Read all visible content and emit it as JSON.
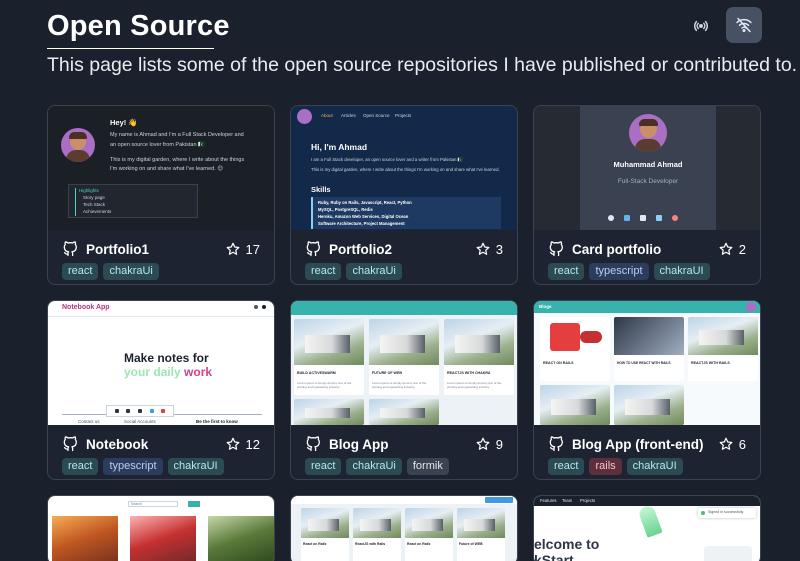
{
  "page": {
    "title": "Open Source",
    "subtitle": "This page lists some of the open source repositories I have published or contributed to."
  },
  "toolbar": {
    "broadcast_icon": "broadcast-icon",
    "wifi_icon": "wifi-off-icon"
  },
  "colors": {
    "background": "#1a202c",
    "card_border": "#3a4252",
    "accent_teal": "#2c4a52"
  },
  "cards": [
    {
      "name": "Portfolio1",
      "stars": "17",
      "tags": [
        "react",
        "chakraUi"
      ]
    },
    {
      "name": "Portfolio2",
      "stars": "3",
      "tags": [
        "react",
        "chakraUi"
      ]
    },
    {
      "name": "Card portfolio",
      "stars": "2",
      "tags": [
        "react",
        "typescript",
        "chakraUI"
      ]
    },
    {
      "name": "Notebook",
      "stars": "12",
      "tags": [
        "react",
        "typescript",
        "chakraUI"
      ]
    },
    {
      "name": "Blog App",
      "stars": "9",
      "tags": [
        "react",
        "chakraUi",
        "formik"
      ]
    },
    {
      "name": "Blog App (front-end)",
      "stars": "6",
      "tags": [
        "react",
        "rails",
        "chakraUI"
      ]
    }
  ],
  "thumbs": {
    "p1": {
      "hey": "Hey! 👋",
      "line1": "My name is Ahmad and I'm a Full Stack Developer and",
      "line2": "an open source lover from Pakistan 🇵🇰",
      "line3": "This is my digital garden, where I write about the things",
      "line4": "I'm working on and share what I've learned. 😊",
      "hl_title": "Highlights",
      "hl": [
        "Story page",
        "Tech Stack",
        "Achievements"
      ]
    },
    "p2": {
      "nav": [
        "About",
        "Articles",
        "Open Source",
        "Projects"
      ],
      "hi": "Hi, I'm Ahmad",
      "line1": "I am a Full Stack developer, an open source lover and a writer from Pakistan 🇵🇰",
      "line2": "This is my digital garden, where I write about the things I'm working on and share what I've learned.",
      "skills": "Skills",
      "skill_lines": [
        "Ruby, Ruby on Rails, Javascript, React, Python",
        "MySQL, PostgreSQL, Redis",
        "Heroku, Amazon Web Services, Digital Ocean",
        "Software Architecture, Project Management"
      ]
    },
    "p3": {
      "name": "Muhammad Ahmad",
      "role": "Full-Stack Developer"
    },
    "nb": {
      "app": "Notebook App",
      "hero1": "Make notes for",
      "hero2a": "your daily ",
      "hero2b": "work",
      "f1": "Contact us",
      "f2": "Social Accounts",
      "f3": "Be the first to know"
    },
    "blog": {
      "posts": [
        "BUILD ACTIVESWARM",
        "FUTURE OF WEB",
        "REACTJS WITH CHAKRA"
      ],
      "body": "Lorem ipsum is simply dummy text of the printing and typesetting industry."
    },
    "blogfe": {
      "brand": "Blogs",
      "posts": [
        "REACT ON RAILS",
        "HOW TO USE REACT WITH RAILS",
        "REACTJS WITH RAILS"
      ]
    },
    "r3": {
      "search": "Search",
      "posts": [
        "React on Rails",
        "ReactJS with Rails",
        "Future of WEB"
      ],
      "nav": [
        "Features",
        "Team",
        "Projects"
      ],
      "hero1": "elcome to",
      "hero2": "kStart",
      "tag": "Signed in successfully"
    }
  }
}
